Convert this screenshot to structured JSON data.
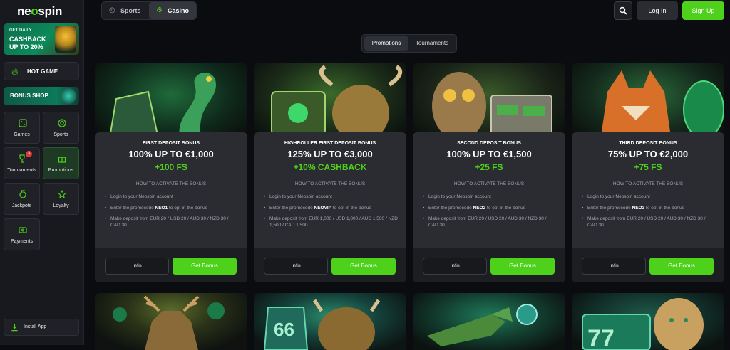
{
  "brand": {
    "logo_pre": "ne",
    "logo_o": "o",
    "logo_post": "spin",
    "accent": "#4ed11a"
  },
  "sidebar": {
    "cashback": {
      "line1": "GET DAILY",
      "line2": "CASHBACK",
      "line3": "UP TO 20%"
    },
    "hot_game": "HOT GAME",
    "bonus_shop": "BONUS SHOP",
    "tiles": [
      {
        "label": "Games",
        "icon": "dice-icon"
      },
      {
        "label": "Sports",
        "icon": "ball-icon"
      },
      {
        "label": "Tournaments",
        "icon": "trophy-icon",
        "badge": "3"
      },
      {
        "label": "Promotions",
        "icon": "gift-icon"
      },
      {
        "label": "Jackpots",
        "icon": "moneybag-icon"
      },
      {
        "label": "Loyalty",
        "icon": "star-icon"
      },
      {
        "label": "Payments",
        "icon": "wallet-icon"
      }
    ],
    "install": "Install App"
  },
  "header": {
    "sports": "Sports",
    "casino": "Casino",
    "login": "Log In",
    "signup": "Sign Up"
  },
  "tabs": {
    "promotions": "Promotions",
    "tournaments": "Tournaments"
  },
  "cards": [
    {
      "kicker": "FIRST DEPOSIT BONUS",
      "headline": "100% UP TO €1,000",
      "extra": "+100 FS",
      "how": "HOW TO ACTIVATE THE BONUS",
      "steps": [
        "Login to your Neospin account",
        "Enter the promocode",
        "NEO1",
        "to opt-in the bonus",
        "Make deposit from EUR 20 / USD 20 / AUD 30 / NZD 30 / CAD 30"
      ],
      "info": "Info",
      "get": "Get Bonus"
    },
    {
      "kicker": "HIGHROLLER FIRST DEPOSIT BONUS",
      "headline": "125% UP TO €3,000",
      "extra": "+10% CASHBACK",
      "how": "HOW TO ACTIVATE THE BONUS",
      "steps": [
        "Login to your Neospin account",
        "Enter the promocode",
        "NEOVIP",
        "to opt-in the bonus",
        "Make deposit from EUR 1,000 / USD 1,000 / AUD 1,500 / NZD 1,500 / CAD 1,500"
      ],
      "info": "Info",
      "get": "Get Bonus"
    },
    {
      "kicker": "SECOND DEPOSIT BONUS",
      "headline": "100% UP TO €1,500",
      "extra": "+25 FS",
      "how": "HOW TO ACTIVATE THE BONUS",
      "steps": [
        "Login to your Neospin account",
        "Enter the promocode",
        "NEO2",
        "to opt-in the bonus",
        "Make deposit from EUR 20 / USD 20 / AUD 30 / NZD 30 / CAD 30"
      ],
      "info": "Info",
      "get": "Get Bonus"
    },
    {
      "kicker": "THIRD DEPOSIT BONUS",
      "headline": "75% UP TO €2,000",
      "extra": "+75 FS",
      "how": "HOW TO ACTIVATE THE BONUS",
      "steps": [
        "Login to your Neospin account",
        "Enter the promocode",
        "NEO3",
        "to opt-in the bonus",
        "Make deposit from EUR 20 / USD 20 / AUD 30 / NZD 30 / CAD 30"
      ],
      "info": "Info",
      "get": "Get Bonus"
    }
  ],
  "art": [
    "snake-treasure-art",
    "bull-treasure-art",
    "owl-treasure-art",
    "fox-treasure-art",
    "deer-art",
    "bison-route66-art",
    "crocodile-art",
    "leopard-slots-art"
  ]
}
